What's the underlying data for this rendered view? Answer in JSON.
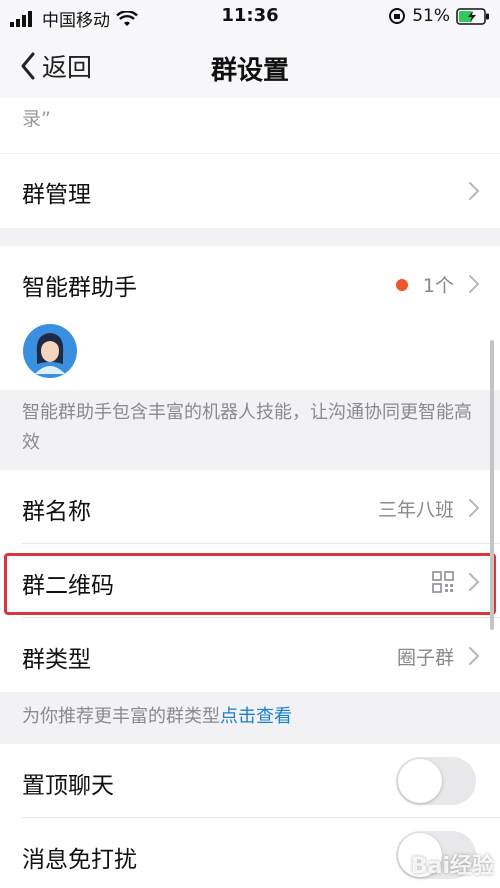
{
  "status_bar": {
    "carrier": "中国移动",
    "time": "11:36",
    "battery": "51%"
  },
  "nav": {
    "back_label": "返回",
    "title": "群设置"
  },
  "top_note": "录”",
  "rows": {
    "group_manage": {
      "title": "群管理"
    },
    "assistant": {
      "title": "智能群助手",
      "count": "1个",
      "desc": "智能群助手包含丰富的机器人技能，让沟通协同更智能高效"
    },
    "group_name": {
      "title": "群名称",
      "value": "三年八班"
    },
    "qr_code": {
      "title": "群二维码"
    },
    "group_type": {
      "title": "群类型",
      "value": "圈子群"
    },
    "type_note": {
      "text": "为你推荐更丰富的群类型",
      "link": "点击查看"
    },
    "pin_chat": {
      "title": "置顶聊天",
      "on": false
    },
    "mute": {
      "title": "消息免打扰",
      "on": false
    }
  },
  "watermark": "Bai经验",
  "colors": {
    "highlight": "#d9363e",
    "link": "#1a80c9",
    "badge_dot": "#f0542d"
  }
}
